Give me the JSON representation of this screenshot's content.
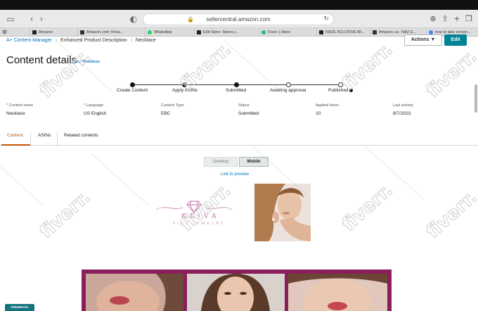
{
  "browser": {
    "url": "sellercentral.amazon.com",
    "tabs": [
      {
        "label": "Amazon",
        "color": "#222222"
      },
      {
        "label": "Amazon.com: Kriva...",
        "color": "#333333"
      },
      {
        "label": "WhatsApp",
        "color": "#25d366"
      },
      {
        "label": "Edit Store: Stores |...",
        "color": "#222222"
      },
      {
        "label": "Fiverr | Inbox",
        "color": "#1dbf73"
      },
      {
        "label": "NAZE XCLUSIVE All...",
        "color": "#222222"
      },
      {
        "label": "Amazon.ca : NAZ E...",
        "color": "#333333"
      },
      {
        "label": "how to take screen...",
        "color": "#4285f4"
      }
    ]
  },
  "breadcrumb": {
    "root": "A+ Content Manager",
    "middle": "Enhanced Product Description",
    "current": "Necklace"
  },
  "header": {
    "title": "Content details",
    "best_practices": "Best Practices",
    "actions_label": "Actions ▼",
    "edit_label": "Edit"
  },
  "stepper": [
    {
      "label": "Create Content",
      "done": true
    },
    {
      "label": "Apply ASINs",
      "done": true
    },
    {
      "label": "Submitted",
      "done": true
    },
    {
      "label": "Awaiting approval",
      "done": false
    },
    {
      "label": "Published",
      "done": false
    }
  ],
  "details": [
    {
      "label": "* Content name",
      "value": "Necklace"
    },
    {
      "label": "* Language",
      "value": "US English"
    },
    {
      "label": "Content Type",
      "value": "EBC"
    },
    {
      "label": "Status",
      "value": "Submitted"
    },
    {
      "label": "Applied Asins",
      "value": "10"
    },
    {
      "label": "Last activity",
      "value": "8/7/2023"
    }
  ],
  "content_tabs": [
    "Content",
    "ASINs",
    "Related contents"
  ],
  "preview": {
    "desktop_label": "Desktop",
    "mobile_label": "Mobile",
    "link_label": "Link to preview"
  },
  "logo": {
    "name": "KRIVA",
    "sub": "FINE JEWELRY"
  },
  "feedback_label": "FEEDBACK",
  "colors": {
    "accent_teal": "#008296",
    "active_tab": "#c45500",
    "link": "#0073bb",
    "banner": "#8b1f5c"
  }
}
